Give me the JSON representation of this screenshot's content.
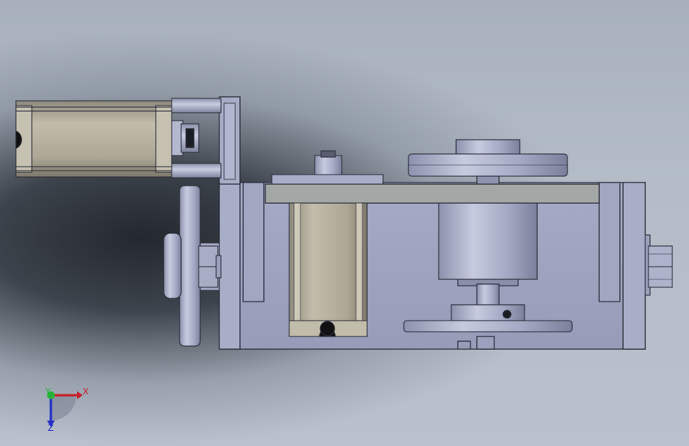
{
  "triad": {
    "x_label": "X",
    "y_label": "Y",
    "z_label": "Z",
    "x_color": "#c8202a",
    "y_color": "#27b33a",
    "z_color": "#2430c8"
  },
  "colors": {
    "part_body": "#9fa4bf",
    "part_edge": "#2b2d3a",
    "part_light": "#c4c8dc",
    "part_dark": "#7d8199",
    "motor_body": "#b3ad9c",
    "plate_grey": "#a3a8a6",
    "shadow": "#1e2329"
  },
  "parts": {
    "stepper_motor_top": "stepper-motor",
    "stepper_motor_vertical": "stepper-motor",
    "flywheel": "flywheel",
    "spindle": "spindle",
    "hex_bolt_left": "hex-bolt",
    "hex_bolt_right": "hex-bolt",
    "base_frame": "base-frame",
    "side_wheel": "side-wheel"
  }
}
